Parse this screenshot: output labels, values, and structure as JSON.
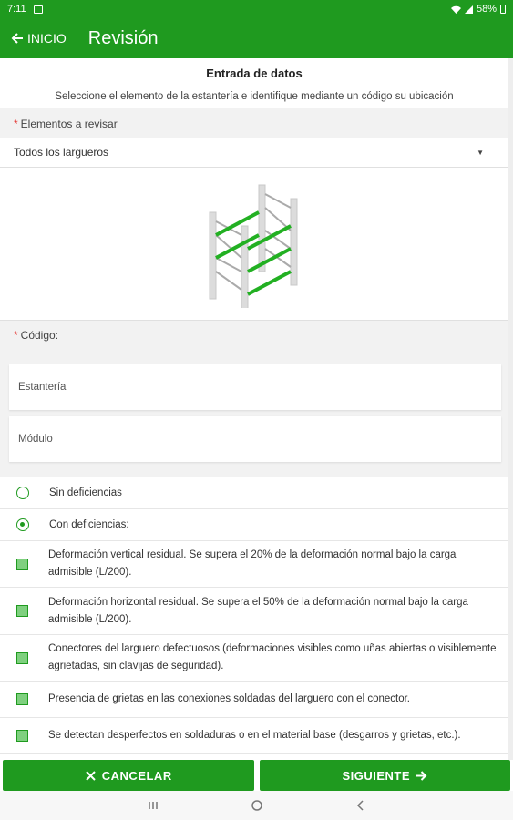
{
  "status": {
    "time": "7:11",
    "battery": "58%"
  },
  "appbar": {
    "back_label": "INICIO",
    "title": "Revisión"
  },
  "header": {
    "title": "Entrada de datos",
    "subtitle": "Seleccione el elemento de la estantería e identifique mediante un código su ubicación"
  },
  "elements": {
    "label": "Elementos a revisar",
    "selected": "Todos los largueros"
  },
  "code": {
    "label": "Código:",
    "field1_placeholder": "Estantería",
    "field2_placeholder": "Módulo"
  },
  "options": {
    "none": "Sin deficiencias",
    "with": "Con deficiencias:",
    "selected": "with"
  },
  "checks": [
    "Deformación vertical residual. Se supera el 20% de la deformación normal bajo la carga admisible (L/200).",
    "Deformación horizontal residual. Se supera el 50% de la deformación normal bajo la carga admisible (L/200).",
    "Conectores del larguero defectuosos (deformaciones visibles como uñas abiertas o visiblemente agrietadas, sin clavijas de seguridad).",
    "Presencia de grietas en las conexiones soldadas del larguero con el conector.",
    "Se detectan desperfectos en soldaduras o en el material base (desgarros y grietas, etc.)."
  ],
  "buttons": {
    "cancel": "CANCELAR",
    "next": "SIGUIENTE"
  },
  "colors": {
    "primary": "#1f9a1f"
  }
}
